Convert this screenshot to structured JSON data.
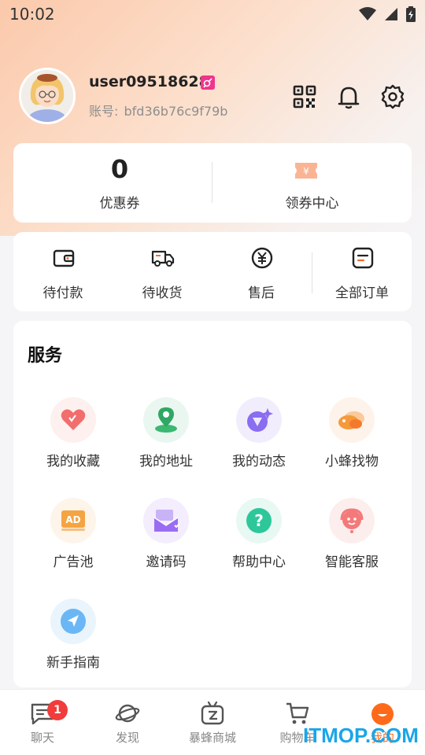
{
  "status_bar": {
    "time": "10:02"
  },
  "profile": {
    "username": "user09518628",
    "account_label": "账号:",
    "account_id": "bfd36b76c9f79b"
  },
  "coupons": {
    "count": "0",
    "count_label": "优惠券",
    "center_label": "领券中心",
    "center_icon_glyph": "¥"
  },
  "orders": {
    "items": [
      {
        "label": "待付款",
        "icon": "wallet-icon"
      },
      {
        "label": "待收货",
        "icon": "truck-icon"
      },
      {
        "label": "售后",
        "icon": "yen-circle-icon"
      },
      {
        "label": "全部订单",
        "icon": "order-list-icon"
      }
    ]
  },
  "services": {
    "title": "服务",
    "items": [
      {
        "label": "我的收藏",
        "icon": "heart-icon",
        "color": "#f26d6d"
      },
      {
        "label": "我的地址",
        "icon": "location-pin-icon",
        "color": "#3bb871"
      },
      {
        "label": "我的动态",
        "icon": "shutter-sparkle-icon",
        "color": "#8a6df0"
      },
      {
        "label": "小蜂找物",
        "icon": "bee-icon",
        "color": "#f59a3c"
      },
      {
        "label": "广告池",
        "icon": "ad-icon",
        "color": "#f5a442",
        "glyph": "AD"
      },
      {
        "label": "邀请码",
        "icon": "invite-envelope-icon",
        "color": "#9b6df2"
      },
      {
        "label": "帮助中心",
        "icon": "help-icon",
        "color": "#2ec79a",
        "glyph": "?"
      },
      {
        "label": "智能客服",
        "icon": "customer-service-icon",
        "color": "#f47a7a"
      },
      {
        "label": "新手指南",
        "icon": "compass-arrow-icon",
        "color": "#4aa6f2"
      }
    ]
  },
  "tab_bar": {
    "tabs": [
      {
        "label": "聊天",
        "icon": "chat-icon",
        "badge": "1"
      },
      {
        "label": "发现",
        "icon": "planet-icon"
      },
      {
        "label": "暴蜂商城",
        "icon": "tv-mall-icon"
      },
      {
        "label": "购物车",
        "icon": "cart-icon"
      },
      {
        "label": "我的",
        "icon": "profile-face-icon"
      }
    ],
    "active_color": "#ff6a1a"
  },
  "watermark": "ITMOP.COM"
}
